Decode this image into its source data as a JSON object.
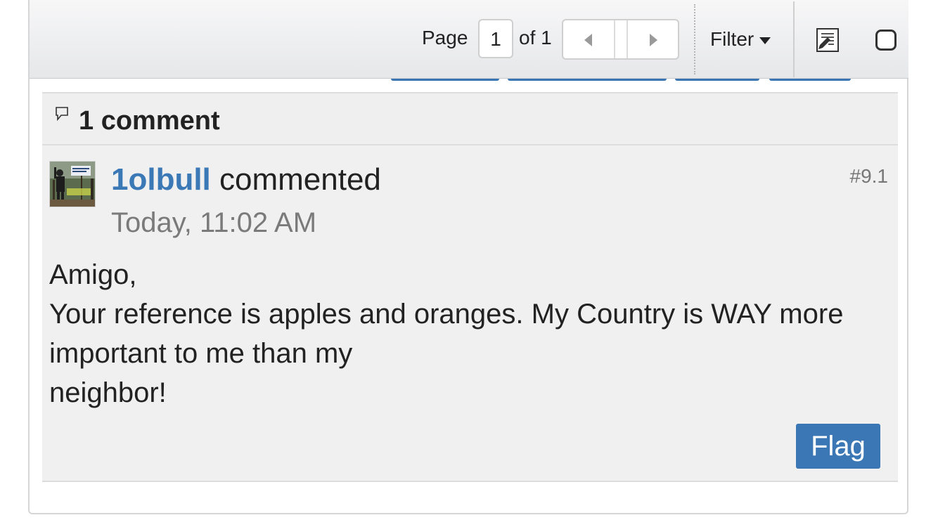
{
  "toolbar": {
    "page_label": "Page",
    "page_value": "1",
    "of_label": "of 1",
    "filter_label": "Filter",
    "icons": [
      "chevron-left-icon",
      "chevron-right-icon",
      "caret-down-icon",
      "edit-note-icon",
      "checkbox-icon"
    ]
  },
  "comments": {
    "count_label": "1 comment",
    "header_icon": "speech-bubble-icon",
    "items": [
      {
        "author": "1olbull",
        "action": "commented",
        "timestamp": "Today, 11:02 AM",
        "ref": "#9.1",
        "body": [
          "Amigo,",
          "Your reference is apples and oranges. My Country is WAY more important to me than my",
          "neighbor!"
        ],
        "flag_label": "Flag"
      }
    ]
  },
  "colors": {
    "link": "#3a78b6",
    "button": "#3b77b4",
    "panel_bg": "#f0f0f0"
  }
}
